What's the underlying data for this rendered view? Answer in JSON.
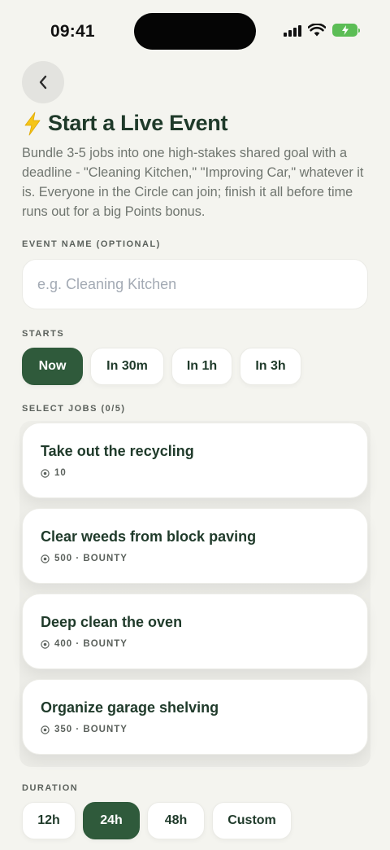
{
  "status_bar": {
    "time": "09:41"
  },
  "header": {
    "title_icon": "lightning-bolt-icon",
    "title": "Start a Live Event",
    "description": "Bundle 3-5 jobs into one high-stakes shared goal with a deadline - \"Cleaning Kitchen,\" \"Improving Car,\" whatever it is. Everyone in the Circle can join; finish it all before time runs out for a big Points bonus."
  },
  "event_name": {
    "label": "EVENT NAME (OPTIONAL)",
    "placeholder": "e.g. Cleaning Kitchen",
    "value": ""
  },
  "starts": {
    "label": "STARTS",
    "options": [
      "Now",
      "In 30m",
      "In 1h",
      "In 3h"
    ],
    "selected": "Now"
  },
  "jobs": {
    "label": "SELECT JOBS (0/5)",
    "items": [
      {
        "title": "Take out the recycling",
        "meta": "10"
      },
      {
        "title": "Clear weeds from block paving",
        "meta": "500 · BOUNTY"
      },
      {
        "title": "Deep clean the oven",
        "meta": "400 · BOUNTY"
      },
      {
        "title": "Organize garage shelving",
        "meta": "350 · BOUNTY"
      }
    ]
  },
  "duration": {
    "label": "DURATION",
    "options": [
      "12h",
      "24h",
      "48h",
      "Custom"
    ],
    "selected": "24h"
  },
  "colors": {
    "background": "#f4f4ef",
    "accent": "#2f5a3b",
    "title": "#1f3a2a",
    "bolt": "#f5c518",
    "battery": "#5bbd55"
  }
}
